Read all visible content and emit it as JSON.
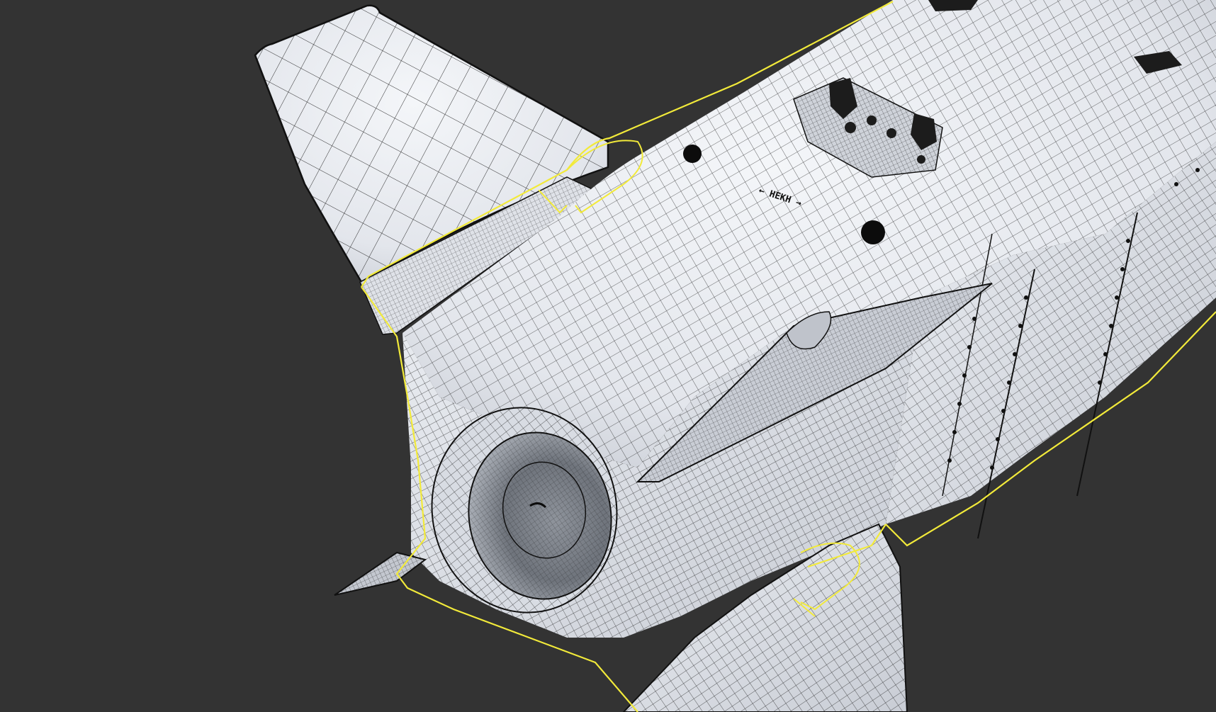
{
  "viewport": {
    "background_color": "#333333",
    "selection_outline_color": "#f2ea3a",
    "wire_color": "#151515",
    "surface_color": "#e8ebf0",
    "shadow_color": "#b5bac4"
  },
  "model": {
    "stencil_text": "← HEKH →",
    "selected": true,
    "display_mode": "wireframe-on-shaded"
  }
}
